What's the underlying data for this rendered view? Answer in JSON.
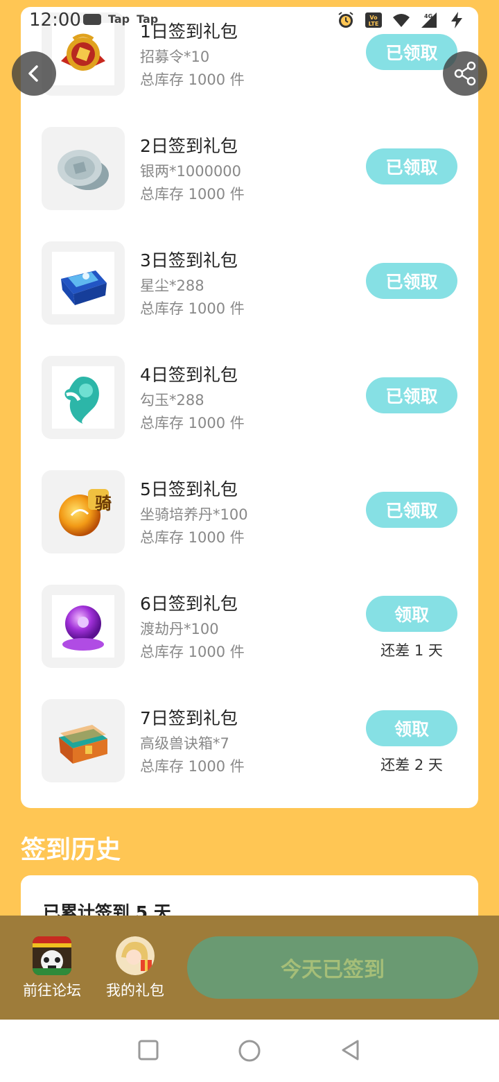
{
  "status": {
    "time": "12:00",
    "app_labels": [
      "Tap",
      "Tap"
    ],
    "volte": "Vo LTE",
    "network": "4G"
  },
  "gifts": [
    {
      "title": "1日签到礼包",
      "desc": "招募令*10",
      "stock": "总库存 1000 件",
      "button": "已领取",
      "remain": "",
      "icon": "token-icon"
    },
    {
      "title": "2日签到礼包",
      "desc": "银两*1000000",
      "stock": "总库存 1000 件",
      "button": "已领取",
      "remain": "",
      "icon": "silver-coin-icon"
    },
    {
      "title": "3日签到礼包",
      "desc": "星尘*288",
      "stock": "总库存 1000 件",
      "button": "已领取",
      "remain": "",
      "icon": "stardust-chest-icon"
    },
    {
      "title": "4日签到礼包",
      "desc": "勾玉*288",
      "stock": "总库存 1000 件",
      "button": "已领取",
      "remain": "",
      "icon": "magatama-icon"
    },
    {
      "title": "5日签到礼包",
      "desc": "坐骑培养丹*100",
      "stock": "总库存 1000 件",
      "button": "已领取",
      "remain": "",
      "icon": "mount-orb-icon",
      "badge": "骑"
    },
    {
      "title": "6日签到礼包",
      "desc": "渡劫丹*100",
      "stock": "总库存 1000 件",
      "button": "领取",
      "remain": "还差 1 天",
      "icon": "purple-orb-icon"
    },
    {
      "title": "7日签到礼包",
      "desc": "高级兽诀箱*7",
      "stock": "总库存 1000 件",
      "button": "领取",
      "remain": "还差 2 天",
      "icon": "treasure-chest-icon"
    }
  ],
  "history": {
    "title": "签到历史",
    "summary": "已累计签到 5 天"
  },
  "bottom": {
    "forum_label": "前往论坛",
    "gifts_label": "我的礼包",
    "signed_label": "今天已签到"
  },
  "colors": {
    "background": "#FFC654",
    "button": "#86E0E4",
    "bottom_bar": "#9E7C3A",
    "signed_button": "#6A9A72"
  }
}
